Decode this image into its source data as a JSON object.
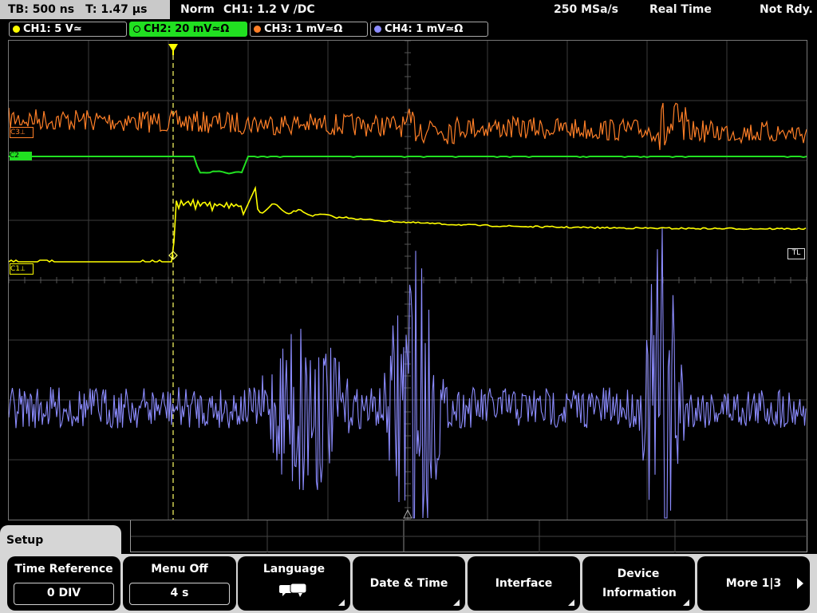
{
  "topbar": {
    "timebase": "TB: 500 ns",
    "trigger_time": "T: 1.47 µs",
    "mode": "Norm",
    "trigger_info": "CH1: 1.2 V ∕DC",
    "sample_rate": "250 MSa/s",
    "acq_mode": "Real Time",
    "status": "Not Rdy."
  },
  "channels": [
    {
      "label": "CH1: 5 V≃",
      "color": "#ffff00",
      "active": false
    },
    {
      "label": "CH2: 20 mV≃Ω",
      "color": "#21e021",
      "active": true
    },
    {
      "label": "CH3: 1 mV≃Ω",
      "color": "#ff7f27",
      "active": false
    },
    {
      "label": "CH4: 1 mV≃Ω",
      "color": "#8c8cff",
      "active": false
    }
  ],
  "screen": {
    "markers": {
      "c3": "C3",
      "c2": "C2",
      "c1": "C1",
      "trigger_level": "TL"
    },
    "trigger_marker": "T"
  },
  "menu": {
    "title": "Setup",
    "softkeys": [
      {
        "label": "Time Reference",
        "value": "0 DIV"
      },
      {
        "label": "Menu Off",
        "value": "4 s"
      },
      {
        "label": "Language",
        "icon": "speech-bubbles-icon"
      },
      {
        "label": "Date & Time"
      },
      {
        "label": "Interface"
      },
      {
        "label": "Device Information"
      },
      {
        "label": "More 1|3"
      }
    ]
  }
}
